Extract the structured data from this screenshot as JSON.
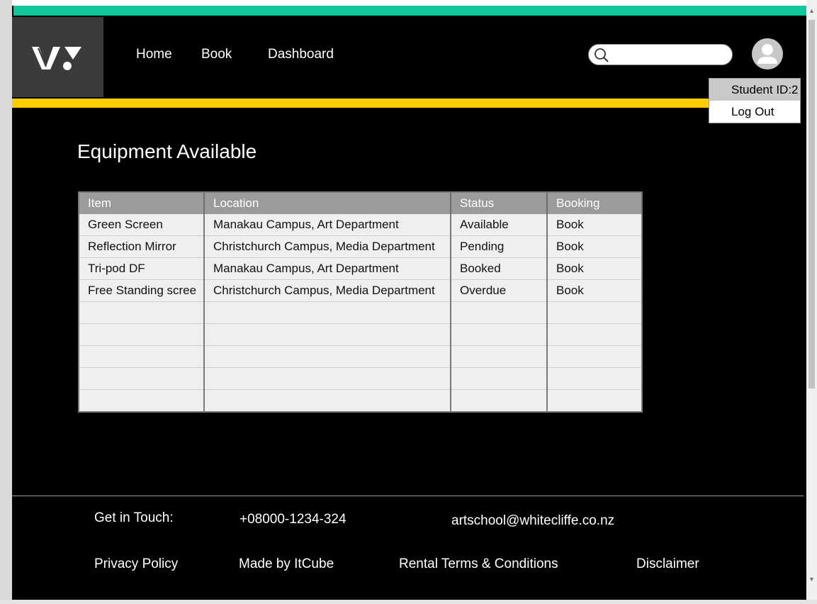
{
  "nav": {
    "links": [
      "Home",
      "Book",
      "Dashboard"
    ]
  },
  "search": {
    "placeholder": "",
    "value": ""
  },
  "user_menu": {
    "items": [
      "Student ID:2",
      "Log Out"
    ]
  },
  "main": {
    "title": "Equipment Available",
    "table": {
      "headers": [
        "Item",
        "Location",
        "Status",
        "Booking"
      ],
      "rows": [
        [
          "Green Screen",
          "Manakau Campus, Art Department",
          "Available",
          "Book"
        ],
        [
          "Reflection Mirror",
          "Christchurch Campus, Media Department",
          "Pending",
          "Book"
        ],
        [
          "Tri-pod DF",
          "Manakau Campus, Art Department",
          "Booked",
          "Book"
        ],
        [
          "Free Standing scree",
          "Christchurch Campus, Media Department",
          "Overdue",
          "Book"
        ]
      ]
    }
  },
  "footer": {
    "contact_label": "Get in Touch:",
    "phone": "+08000-1234-324",
    "email": "artschool@whitecliffe.co.nz",
    "links": [
      "Privacy Policy",
      "Made by ItCube",
      "Rental Terms & Conditions",
      "Disclaimer"
    ]
  },
  "colors": {
    "accent_teal": "#0fc79a",
    "accent_yellow": "#ffcc00",
    "background": "#000000",
    "table_header": "#9b9b9b"
  },
  "icons": [
    "logo-icon",
    "search-icon",
    "user-avatar-icon"
  ]
}
